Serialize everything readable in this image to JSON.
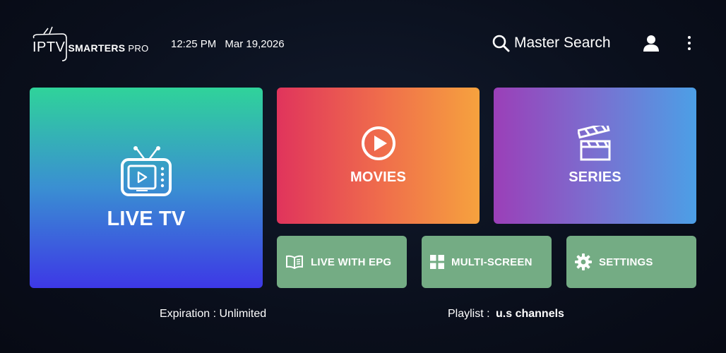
{
  "header": {
    "logo": {
      "iptv": "IPTV",
      "smarters": "SMARTERS",
      "pro": "PRO"
    },
    "time": "12:25 PM",
    "date": "Mar 19,2026",
    "search_label": "Master Search"
  },
  "tiles": {
    "live_tv": "LIVE TV",
    "movies": "MOVIES",
    "series": "SERIES",
    "live_epg": "LIVE WITH EPG",
    "multi_screen": "MULTI-SCREEN",
    "settings": "SETTINGS"
  },
  "footer": {
    "expiration_label": "Expiration : ",
    "expiration_value": "Unlimited",
    "playlist_label": "Playlist : ",
    "playlist_value": "u.s channels"
  },
  "colors": {
    "background": "#0a0f1c",
    "live_tv_gradient": [
      "#2fd39a",
      "#3d38e6"
    ],
    "movies_gradient": [
      "#e0345c",
      "#f6a23e"
    ],
    "series_gradient": [
      "#9b3fb8",
      "#4c9fe6"
    ],
    "small_tile": "#74ac84"
  },
  "icons": {
    "live_tv": "tv-icon",
    "movies": "play-circle-icon",
    "series": "clapperboard-icon",
    "live_epg": "book-icon",
    "multi_screen": "grid-icon",
    "settings": "gear-icon",
    "search": "search-icon",
    "user": "user-icon",
    "more": "more-vertical-icon"
  }
}
